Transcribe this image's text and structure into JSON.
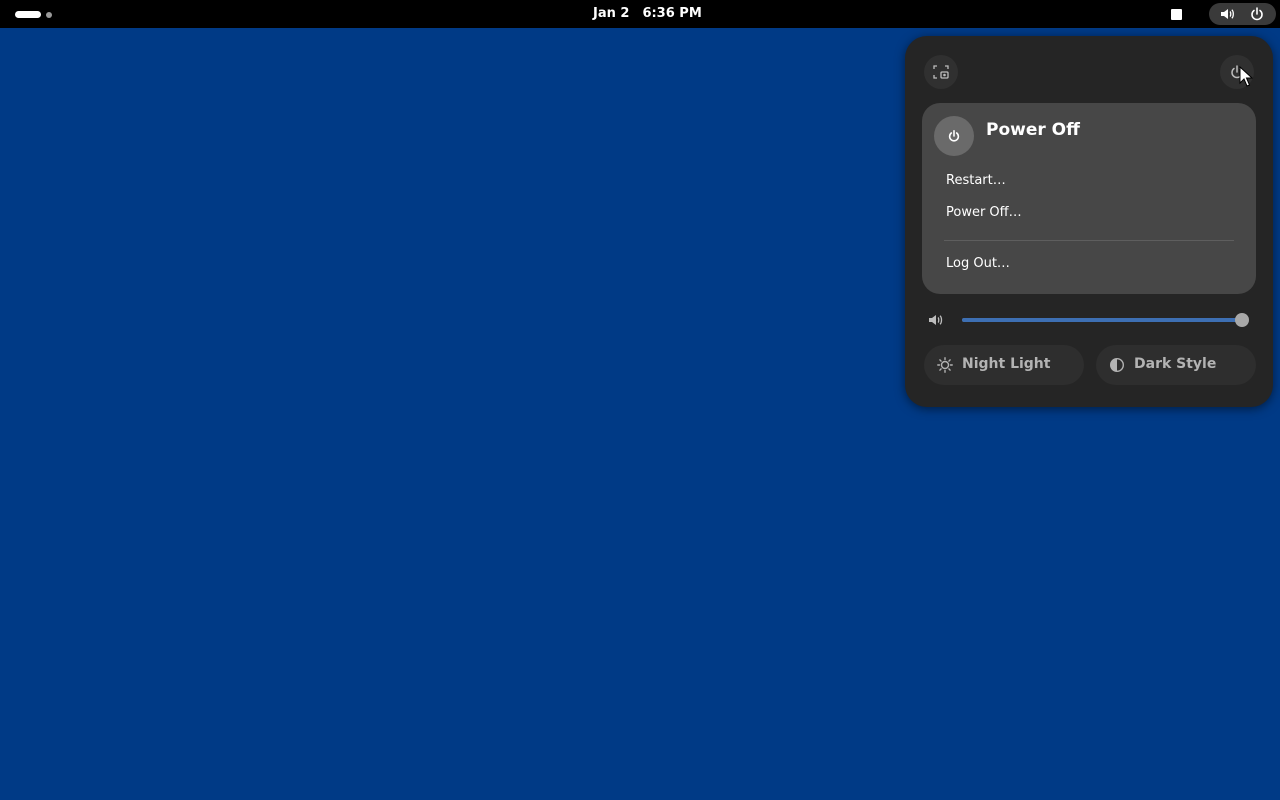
{
  "topbar": {
    "date": "Jan 2",
    "time": "6:36 PM",
    "indicators": [
      "speaker-icon",
      "power-icon"
    ]
  },
  "quick_settings": {
    "top_buttons": [
      "screenshot-icon",
      "power-icon"
    ],
    "power_menu": {
      "title": "Power Off",
      "items": [
        "Restart…",
        "Power Off…",
        "Log Out…"
      ]
    },
    "volume": {
      "icon": "speaker-icon",
      "level": 1.0
    },
    "toggles": [
      {
        "label": "Night Light",
        "icon": "sun-icon",
        "active": false
      },
      {
        "label": "Dark Style",
        "icon": "contrast-icon",
        "active": false
      }
    ]
  },
  "colors": {
    "desktop": "#003a86",
    "topbar": "#000000",
    "panel": "#252525",
    "power_menu": "#474747",
    "slider_fill": "#3d6fb3"
  }
}
